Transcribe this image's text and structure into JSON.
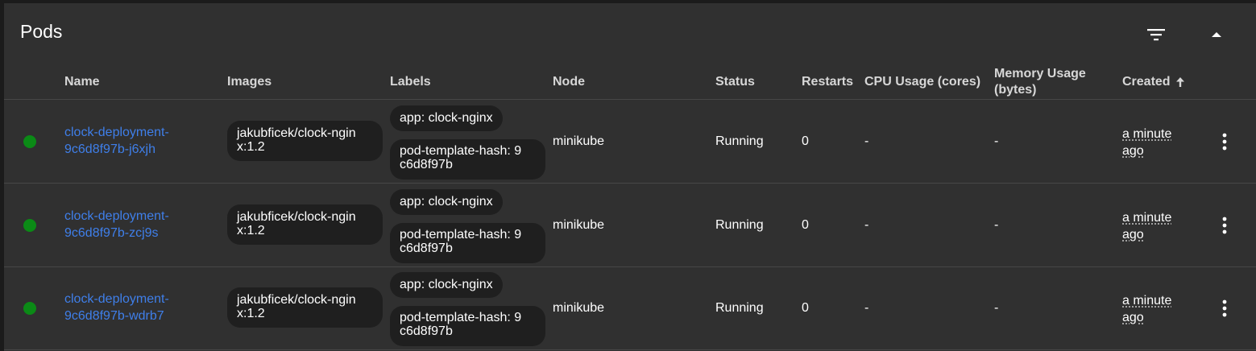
{
  "card": {
    "title": "Pods",
    "filter_icon": "filter-list-icon",
    "collapse_icon": "arrow-up-icon"
  },
  "columns": {
    "name": "Name",
    "images": "Images",
    "labels": "Labels",
    "node": "Node",
    "status": "Status",
    "restarts": "Restarts",
    "cpu": "CPU Usage (cores)",
    "memory_line1": "Memory Usage",
    "memory_line2": "(bytes)",
    "created": "Created",
    "created_sort_icon": "arrow-upward-icon"
  },
  "colors": {
    "status_running": "#0b8a16",
    "link": "#3f7fea"
  },
  "pods": [
    {
      "name_line1": "clock-deployment-",
      "name_line2": "9c6d8f97b-j6xjh",
      "image_line1": "jakubficek/clock-ngin",
      "image_line2": "x:1.2",
      "label_app": "app: clock-nginx",
      "label_hash_line1": "pod-template-hash: 9",
      "label_hash_line2": "c6d8f97b",
      "node": "minikube",
      "status": "Running",
      "restarts": "0",
      "cpu": "-",
      "memory": "-",
      "created_line1": "a minute",
      "created_line2": "ago"
    },
    {
      "name_line1": "clock-deployment-",
      "name_line2": "9c6d8f97b-zcj9s",
      "image_line1": "jakubficek/clock-ngin",
      "image_line2": "x:1.2",
      "label_app": "app: clock-nginx",
      "label_hash_line1": "pod-template-hash: 9",
      "label_hash_line2": "c6d8f97b",
      "node": "minikube",
      "status": "Running",
      "restarts": "0",
      "cpu": "-",
      "memory": "-",
      "created_line1": "a minute",
      "created_line2": "ago"
    },
    {
      "name_line1": "clock-deployment-",
      "name_line2": "9c6d8f97b-wdrb7",
      "image_line1": "jakubficek/clock-ngin",
      "image_line2": "x:1.2",
      "label_app": "app: clock-nginx",
      "label_hash_line1": "pod-template-hash: 9",
      "label_hash_line2": "c6d8f97b",
      "node": "minikube",
      "status": "Running",
      "restarts": "0",
      "cpu": "-",
      "memory": "-",
      "created_line1": "a minute",
      "created_line2": "ago"
    }
  ]
}
